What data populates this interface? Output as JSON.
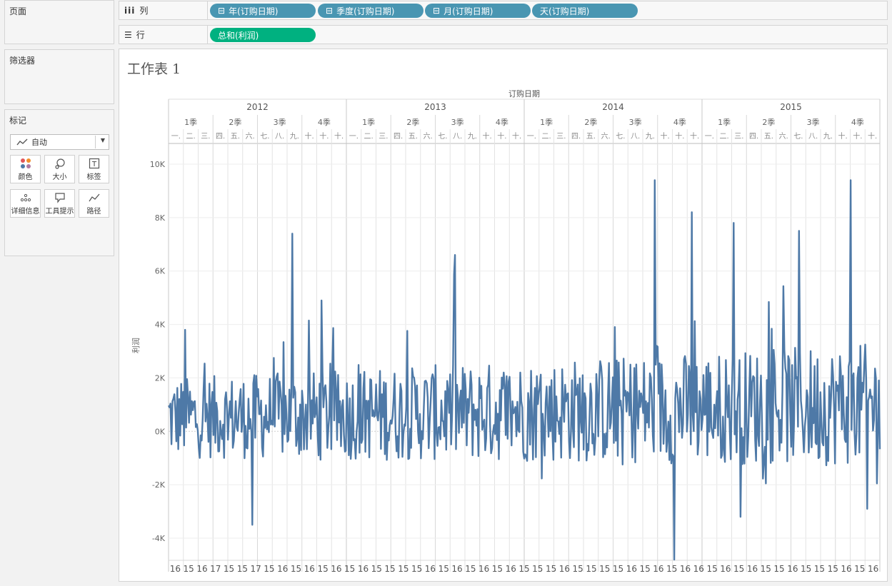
{
  "left_panel": {
    "pages_title": "页面",
    "filters_title": "筛选器",
    "marks": {
      "title": "标记",
      "dropdown_value": "自动",
      "buttons": [
        {
          "label": "颜色",
          "icon": "color-dots-icon"
        },
        {
          "label": "大小",
          "icon": "size-icon"
        },
        {
          "label": "标签",
          "icon": "label-t-icon"
        },
        {
          "label": "详细信息",
          "icon": "detail-icon"
        },
        {
          "label": "工具提示",
          "icon": "tooltip-icon"
        },
        {
          "label": "路径",
          "icon": "path-icon"
        }
      ]
    }
  },
  "shelves": {
    "columns": {
      "label": "列",
      "pills": [
        {
          "text": "年(订购日期)",
          "prefix": "⊟"
        },
        {
          "text": "季度(订购日期)",
          "prefix": "⊟"
        },
        {
          "text": "月(订购日期)",
          "prefix": "⊟"
        },
        {
          "text": "天(订购日期)",
          "prefix": ""
        }
      ]
    },
    "rows": {
      "label": "行",
      "pills": [
        {
          "text": "总和(利润)"
        }
      ]
    }
  },
  "worksheet": {
    "title": "工作表 1"
  },
  "chart_data": {
    "type": "line",
    "xlabel": "订购日期",
    "ylabel": "利润",
    "color": "#4e79a7",
    "ylim": [
      -5000,
      10000
    ],
    "y_ticks": [
      "10K",
      "8K",
      "6K",
      "4K",
      "2K",
      "0K",
      "-2K",
      "-4K"
    ],
    "y_tick_values": [
      10000,
      8000,
      6000,
      4000,
      2000,
      0,
      -2000,
      -4000
    ],
    "years": [
      "2012",
      "2013",
      "2014",
      "2015"
    ],
    "quarters": [
      "1季",
      "2季",
      "3季",
      "4季"
    ],
    "months": [
      "一.",
      "二.",
      "三.",
      "四.",
      "五.",
      "六.",
      "七.",
      "八.",
      "九.",
      "十.",
      "十.",
      "十."
    ],
    "bottom_day_labels": [
      "16",
      "15",
      "16",
      "17",
      "15",
      "15",
      "17",
      "15",
      "16",
      "15",
      "16",
      "15",
      "16",
      "15",
      "16",
      "15",
      "15",
      "15",
      "15",
      "16",
      "15",
      "16",
      "15",
      "16",
      "15",
      "16",
      "15",
      "15",
      "15",
      "16",
      "15",
      "15",
      "15",
      "15",
      "16",
      "15",
      "16",
      "15",
      "16",
      "16",
      "15",
      "16",
      "15",
      "16",
      "15",
      "15",
      "16",
      "15",
      "15",
      "15",
      "16",
      "15",
      "16"
    ],
    "series": [
      {
        "name": "总和(利润)",
        "peaks": [
          {
            "x": "2012-02-05",
            "y": 3800
          },
          {
            "x": "2012-06-22",
            "y": -3500
          },
          {
            "x": "2012-09-12",
            "y": 7400
          },
          {
            "x": "2012-11-10",
            "y": 4900
          },
          {
            "x": "2013-08-12",
            "y": 6600
          },
          {
            "x": "2014-09-25",
            "y": 9400
          },
          {
            "x": "2014-11-05",
            "y": -4800
          },
          {
            "x": "2014-12-10",
            "y": 8200
          },
          {
            "x": "2015-03-06",
            "y": 7800
          },
          {
            "x": "2015-03-20",
            "y": -3200
          },
          {
            "x": "2015-07-18",
            "y": 7500
          },
          {
            "x": "2015-11-01",
            "y": 9400
          },
          {
            "x": "2015-12-05",
            "y": -2900
          }
        ]
      }
    ]
  }
}
